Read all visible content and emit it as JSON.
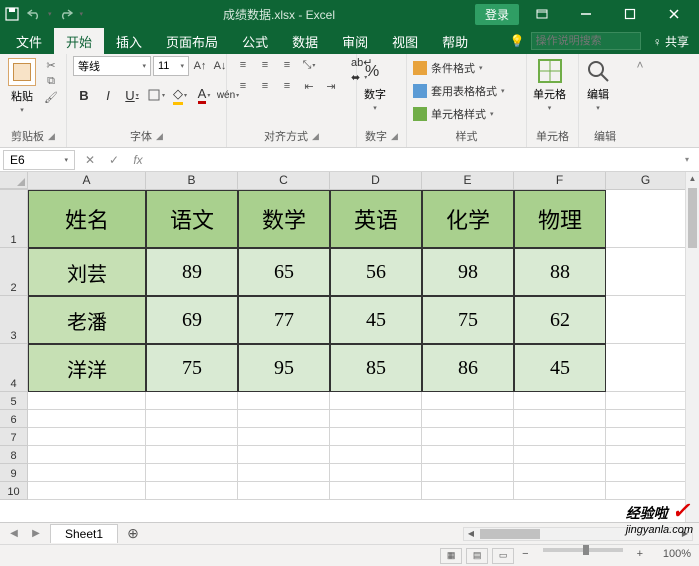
{
  "title": "成绩数据.xlsx - Excel",
  "login": "登录",
  "tabs": {
    "file": "文件",
    "home": "开始",
    "insert": "插入",
    "layout": "页面布局",
    "formulas": "公式",
    "data": "数据",
    "review": "审阅",
    "view": "视图",
    "help": "帮助"
  },
  "tellme_placeholder": "操作说明搜索",
  "share": "共享",
  "ribbon": {
    "clipboard": {
      "paste": "粘贴",
      "label": "剪贴板"
    },
    "font": {
      "name": "等线",
      "size": "11",
      "label": "字体"
    },
    "align": {
      "wrap": "",
      "merge": "",
      "label": "对齐方式"
    },
    "number": {
      "btn": "数字",
      "label": "数字"
    },
    "styles": {
      "cond": "条件格式",
      "table": "套用表格格式",
      "cell": "单元格样式",
      "label": "样式"
    },
    "cells": {
      "btn": "单元格",
      "label": "单元格"
    },
    "edit": {
      "btn": "编辑",
      "label": "编辑"
    }
  },
  "namebox": "E6",
  "formula": "",
  "columns": [
    "A",
    "B",
    "C",
    "D",
    "E",
    "F",
    "G"
  ],
  "row_numbers": [
    "1",
    "2",
    "3",
    "4",
    "5",
    "6",
    "7",
    "8",
    "9",
    "10"
  ],
  "table": {
    "headers": [
      "姓名",
      "语文",
      "数学",
      "英语",
      "化学",
      "物理"
    ],
    "rows": [
      {
        "name": "刘芸",
        "scores": [
          "89",
          "65",
          "56",
          "98",
          "88"
        ]
      },
      {
        "name": "老潘",
        "scores": [
          "69",
          "77",
          "45",
          "75",
          "62"
        ]
      },
      {
        "name": "洋洋",
        "scores": [
          "75",
          "95",
          "85",
          "86",
          "45"
        ]
      }
    ]
  },
  "sheet_tab": "Sheet1",
  "zoom": "100%",
  "watermark": {
    "main": "经验啦",
    "sub": "jingyanla.com"
  }
}
